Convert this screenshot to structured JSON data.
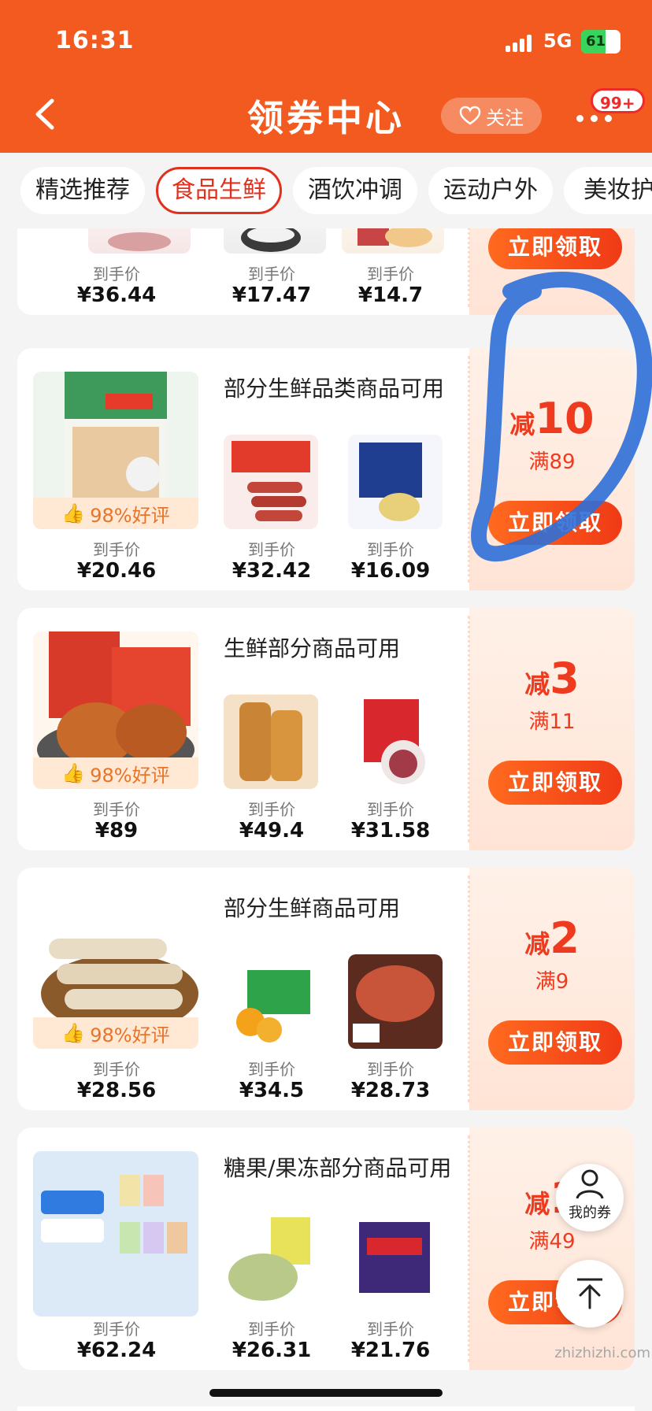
{
  "status_bar": {
    "time": "16:31",
    "network": "5G",
    "battery": "61"
  },
  "nav": {
    "title": "领券中心",
    "follow_label": "关注",
    "message_badge": "99+"
  },
  "tabs": [
    "精选推荐",
    "食品生鲜",
    "酒饮冲调",
    "运动户外",
    "美妆护肤"
  ],
  "active_tab": "食品生鲜",
  "card_common": {
    "price_label": "到手价",
    "claim_label": "立即领取",
    "jian": "减"
  },
  "cards": [
    {
      "title": "",
      "rating": "",
      "discount": "",
      "threshold": "",
      "prices": [
        "¥36.44",
        "¥17.47",
        "¥14.7"
      ]
    },
    {
      "title": "部分生鲜品类商品可用",
      "rating": "98%好评",
      "discount": "10",
      "threshold": "满89",
      "prices": [
        "¥20.46",
        "¥32.42",
        "¥16.09"
      ]
    },
    {
      "title": "生鲜部分商品可用",
      "rating": "98%好评",
      "discount": "3",
      "threshold": "满11",
      "prices": [
        "¥89",
        "¥49.4",
        "¥31.58"
      ]
    },
    {
      "title": "部分生鲜商品可用",
      "rating": "98%好评",
      "discount": "2",
      "threshold": "满9",
      "prices": [
        "¥28.56",
        "¥34.5",
        "¥28.73"
      ]
    },
    {
      "title": "糖果/果冻部分商品可用",
      "rating": "",
      "discount": "1",
      "threshold": "满49",
      "prices": [
        "¥62.24",
        "¥26.31",
        "¥21.76"
      ]
    }
  ],
  "floating": {
    "my_coupon_label": "我的券"
  },
  "watermark": "zhizhizhi.com",
  "colors": {
    "brand_orange": "#f25a1f",
    "discount_red": "#ee3b1f",
    "annotation_blue": "#2f6fd8"
  }
}
